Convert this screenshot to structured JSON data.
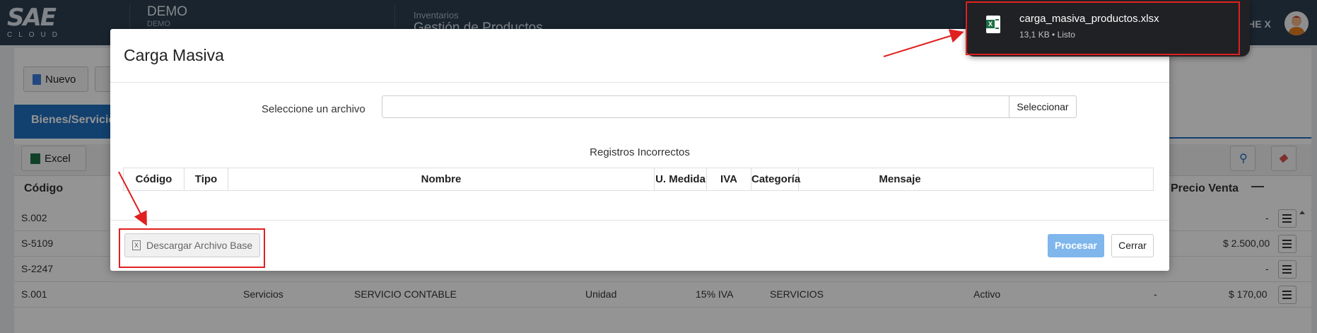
{
  "header": {
    "logo_text": "SAE",
    "logo_subtext": "CLOUD",
    "company_name": "DEMO",
    "company_sub": "DEMO",
    "module": "Inventarios",
    "page": "Gestión de Productos",
    "user_name": "CHE X"
  },
  "page_bg": {
    "new_button": "Nuevo",
    "tab_label": "Bienes/Servicios",
    "excel_button": "Excel",
    "columns": [
      "Código",
      "Precio Venta"
    ],
    "rows": [
      {
        "code": "S.002",
        "price": "-"
      },
      {
        "code": "S-5109",
        "price": "$ 2.500,00"
      },
      {
        "code": "S-2247",
        "price": "-"
      },
      {
        "code": "S.001",
        "type": "Servicios",
        "name": "SERVICIO CONTABLE",
        "unit": "Unidad",
        "iva": "15% IVA",
        "category": "SERVICIOS",
        "status": "Activo",
        "dash": "-",
        "price": "$ 170,00"
      }
    ]
  },
  "modal": {
    "title": "Carga Masiva",
    "file_label": "Seleccione un archivo",
    "file_value": "",
    "select_button": "Seleccionar",
    "section_title": "Registros Incorrectos",
    "columns": [
      "Código",
      "Tipo",
      "Nombre",
      "U. Medida",
      "IVA",
      "Categoría",
      "Mensaje"
    ],
    "download_button": "Descargar Archivo Base",
    "process_button": "Procesar",
    "close_button": "Cerrar"
  },
  "download_popup": {
    "file_name": "carga_masiva_productos.xlsx",
    "meta": "13,1 KB • Listo",
    "icon_letter": "X"
  },
  "colors": {
    "accent": "#1f6fbf",
    "annotation": "#e02020",
    "popup_bg": "#202124"
  }
}
